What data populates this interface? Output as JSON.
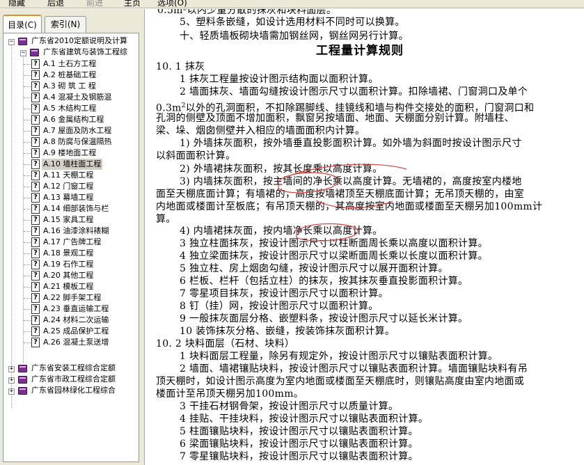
{
  "toolbar": {
    "hide": "隐藏",
    "back": "后退",
    "forward": "前进",
    "home": "主页",
    "options": "选项(O)"
  },
  "tabs": {
    "contents": "目录(C)",
    "index": "索引(N)"
  },
  "tree": {
    "root": "广东省2010定额说明及计算",
    "sub1": "广东省建筑与装饰工程综",
    "items": [
      "A.1  土石方工程",
      "A.2  桩基础工程",
      "A.3  砌 筑 工 程",
      "A.4  混凝土及钢筋混",
      "A.5  木结构工程",
      "A.6  金属结构工程",
      "A.7  屋面及防水工程",
      "A.8  防腐与保温隔热",
      "A.9  楼地面工程",
      "A.10  墙柱面工程",
      "A.11  天棚工程",
      "A.12  门窗工程",
      "A.13  幕墙工程",
      "A.14  细部装饰与栏",
      "A.15  家具工程",
      "A.16  油漆涂料裱糊",
      "A.17  广告牌工程",
      "A.18  景观工程",
      "A.19  石作工程",
      "A.20  其他工程",
      "A.21  模板工程",
      "A.22  脚手架工程",
      "A.23  垂直运输工程",
      "A.24  材料二次运输",
      "A.25  成品保护工程",
      "A.26  混凝土泵送增"
    ],
    "others": [
      "广东省安装工程综合定额",
      "广东省市政工程综合定额",
      "广东省园林绿化工程综合"
    ]
  },
  "doc": {
    "l0": "0.5m²以内少量分散的抹灰和块料面层。",
    "l1": "5、塑料条嵌缝，如设计选用材料不同时可以换算。",
    "l2": "十、轻质墙板砌块墙需加钢丝网，钢丝网另行计算。",
    "title": "工程量计算规则",
    "l3": "10. 1  抹灰",
    "l4": "1   抹灰工程量按设计图示结构面以面积计算。",
    "l5": "2   墙面抹灰、墙面勾缝按设计图示尺寸以面积计算。扣除墙裙、门窗洞口及单个",
    "l6a": "0.3m",
    "l6b": "2",
    "l6c": "以外的孔洞面积，不扣除踢脚线、挂镜线和墙与构件交接处的面积，门窗洞口和",
    "l7": "孔洞的侧壁及顶面不增加面积，飘窗另按墙面、地面、天棚面分别计算。附墙柱、",
    "l8": "梁、垛、烟囱侧壁并入相应的墙面面积内计算。",
    "l9": "1)   外墙抹灰面积，按外墙垂直投影面积计算。如外墙为斜面时按设计图示尺寸",
    "l10": "以斜面面积计算。",
    "l11": "2)   外墙裙抹灰面积，按其长度乘以高度计算。",
    "l12": "3)   内墙抹灰面积，按主墙间的净长乘以高度计算。无墙裙的，高度按室内楼地",
    "l13": "面至天棚底面计算；有墙裙的，高度按墙裙顶至天棚底面计算；无吊顶天棚的，由室",
    "l14": "内地面或楼面计至板底；有吊顶天棚的，其高度按室内地面或楼面至天棚另加100mm计",
    "l15": "算。",
    "l16": "4)   内墙裙抹灰面，按内墙净长乘以高度计算。",
    "l17": "3   独立柱面抹灰，按设计图示尺寸以柱断面周长乘以高度以面积计算。",
    "l18": "4   独立梁面抹灰，按设计图示尺寸以梁断面周长乘以长度以面积计算。",
    "l19": "5   独立柱、房上烟囱勾缝，按设计图示尺寸以展开面积计算。",
    "l20": "6   栏板、栏杆（包括立柱）的抹灰，按其抹灰垂直投影面积计算。",
    "l21": "7   零星项目抹灰，按设计图示尺寸以面积计算。",
    "l22": "8   钉（挂）网，按设计图示尺寸以面积计算。",
    "l23": "9   一般抹灰面层分格、嵌塑料条，按设计图示尺寸以延长米计算。",
    "l24": "10   装饰抹灰分格、嵌缝，按装饰抹灰面积计算。",
    "l25": "10. 2  块料面层（石材、块料）",
    "l26": "1   块料面层工程量，除另有规定外，按设计图示尺寸以镶贴表面积计算。",
    "l27": "2   墙面、墙裙镶贴块料，按设计图示尺寸以镶贴表面积计算。墙面镶贴块料有吊",
    "l28": "顶天棚时，如设计图示高度为室内地面或楼面至天棚底时，则镶贴高度由室内地面或",
    "l29": "楼面计至吊顶天棚另加100mm。",
    "l30": "3   干挂石材钢骨架，按设计图示尺寸以质量计算。",
    "l31": "4   挂贴、干挂块料，按设计图示尺寸以镶贴表面积计算。",
    "l32": "5   柱面镶贴块料，按设计图示尺寸以镶贴表面积计算。",
    "l33": "6   梁面镶贴块料，按设计图示尺寸以镶贴表面积计算。",
    "l34": "7   零星镶贴块料，按设计图示尺寸以镶贴表面积计算。"
  },
  "colors": {
    "annotation": "#d94040",
    "book": "#7b2f8f",
    "panel": "#ece9d8"
  }
}
